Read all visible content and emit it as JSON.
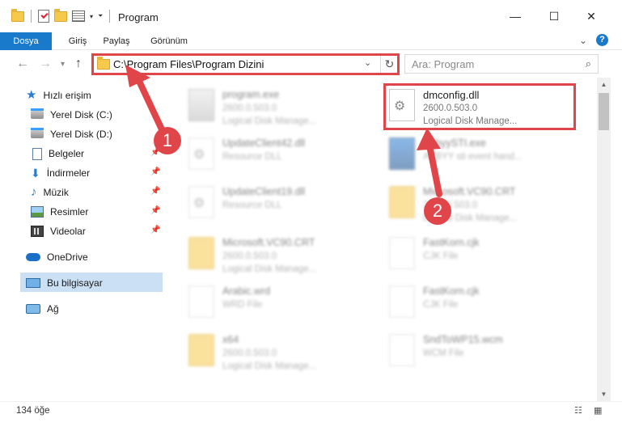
{
  "window": {
    "title": "Program",
    "minimize_icon": "minimize-icon",
    "maximize_icon": "maximize-icon",
    "close_icon": "close-icon"
  },
  "ribbon": {
    "tabs": [
      {
        "label": "Dosya"
      },
      {
        "label": "Giriş"
      },
      {
        "label": "Paylaş"
      },
      {
        "label": "Görünüm"
      }
    ],
    "accent": "#1979ca"
  },
  "nav": {
    "address": "C:\\Program Files\\Program Dizini",
    "search_placeholder": "Ara: Program"
  },
  "sidebar": {
    "items": [
      {
        "label": "Hızlı erişim",
        "icon": "star-icon"
      },
      {
        "label": "Yerel Disk (C:)",
        "icon": "disk-icon"
      },
      {
        "label": "Yerel Disk (D:)",
        "icon": "disk-icon"
      },
      {
        "label": "Belgeler",
        "icon": "documents-icon"
      },
      {
        "label": "İndirmeler",
        "icon": "downloads-icon"
      },
      {
        "label": "Müzik",
        "icon": "music-icon"
      },
      {
        "label": "Resimler",
        "icon": "pictures-icon"
      },
      {
        "label": "Videolar",
        "icon": "videos-icon"
      },
      {
        "label": "OneDrive",
        "icon": "cloud-icon"
      },
      {
        "label": "Bu bilgisayar",
        "icon": "computer-icon"
      },
      {
        "label": "Ağ",
        "icon": "network-icon"
      }
    ],
    "selected": "Bu bilgisayar"
  },
  "files": [
    {
      "name": "program.exe",
      "line2": "2600.0.503.0",
      "line3": "Logical Disk Manage...",
      "icon": "exe-icon"
    },
    {
      "name": "dmconfig.dll",
      "line2": "2600.0.503.0",
      "line3": "Logical Disk Manage...",
      "icon": "dll-icon"
    },
    {
      "name": "UpdateClient42.dll",
      "line2": "Resource DLL",
      "line3": "",
      "icon": "dll-icon"
    },
    {
      "name": "AbbyySTI.exe",
      "line2": "ABBYY sti event hand...",
      "line3": "",
      "icon": "exe-icon"
    },
    {
      "name": "UpdateClient19.dll",
      "line2": "Resource DLL",
      "line3": "",
      "icon": "dll-icon"
    },
    {
      "name": "Microsoft.VC90.CRT",
      "line2": "2600.0.503.0",
      "line3": "Logical Disk Manage...",
      "icon": "folder-icon"
    },
    {
      "name": "Microsoft.VC90.CRT",
      "line2": "2600.0.503.0",
      "line3": "Logical Disk Manage...",
      "icon": "folder-icon"
    },
    {
      "name": "FastKorn.cjk",
      "line2": "CJK File",
      "line3": "",
      "icon": "file-icon"
    },
    {
      "name": "Arabic.wrd",
      "line2": "WRD File",
      "line3": "",
      "icon": "file-icon"
    },
    {
      "name": "FastKorn.cjk",
      "line2": "CJK File",
      "line3": "",
      "icon": "file-icon"
    },
    {
      "name": "x64",
      "line2": "2600.0.503.0",
      "line3": "Logical Disk Manage...",
      "icon": "folder-icon"
    },
    {
      "name": "SndToWP15.wcm",
      "line2": "WCM File",
      "line3": "",
      "icon": "file-icon"
    }
  ],
  "status": {
    "count": "134 öğe"
  },
  "annotations": {
    "badge1": "1",
    "badge2": "2",
    "color": "#e0454a"
  }
}
